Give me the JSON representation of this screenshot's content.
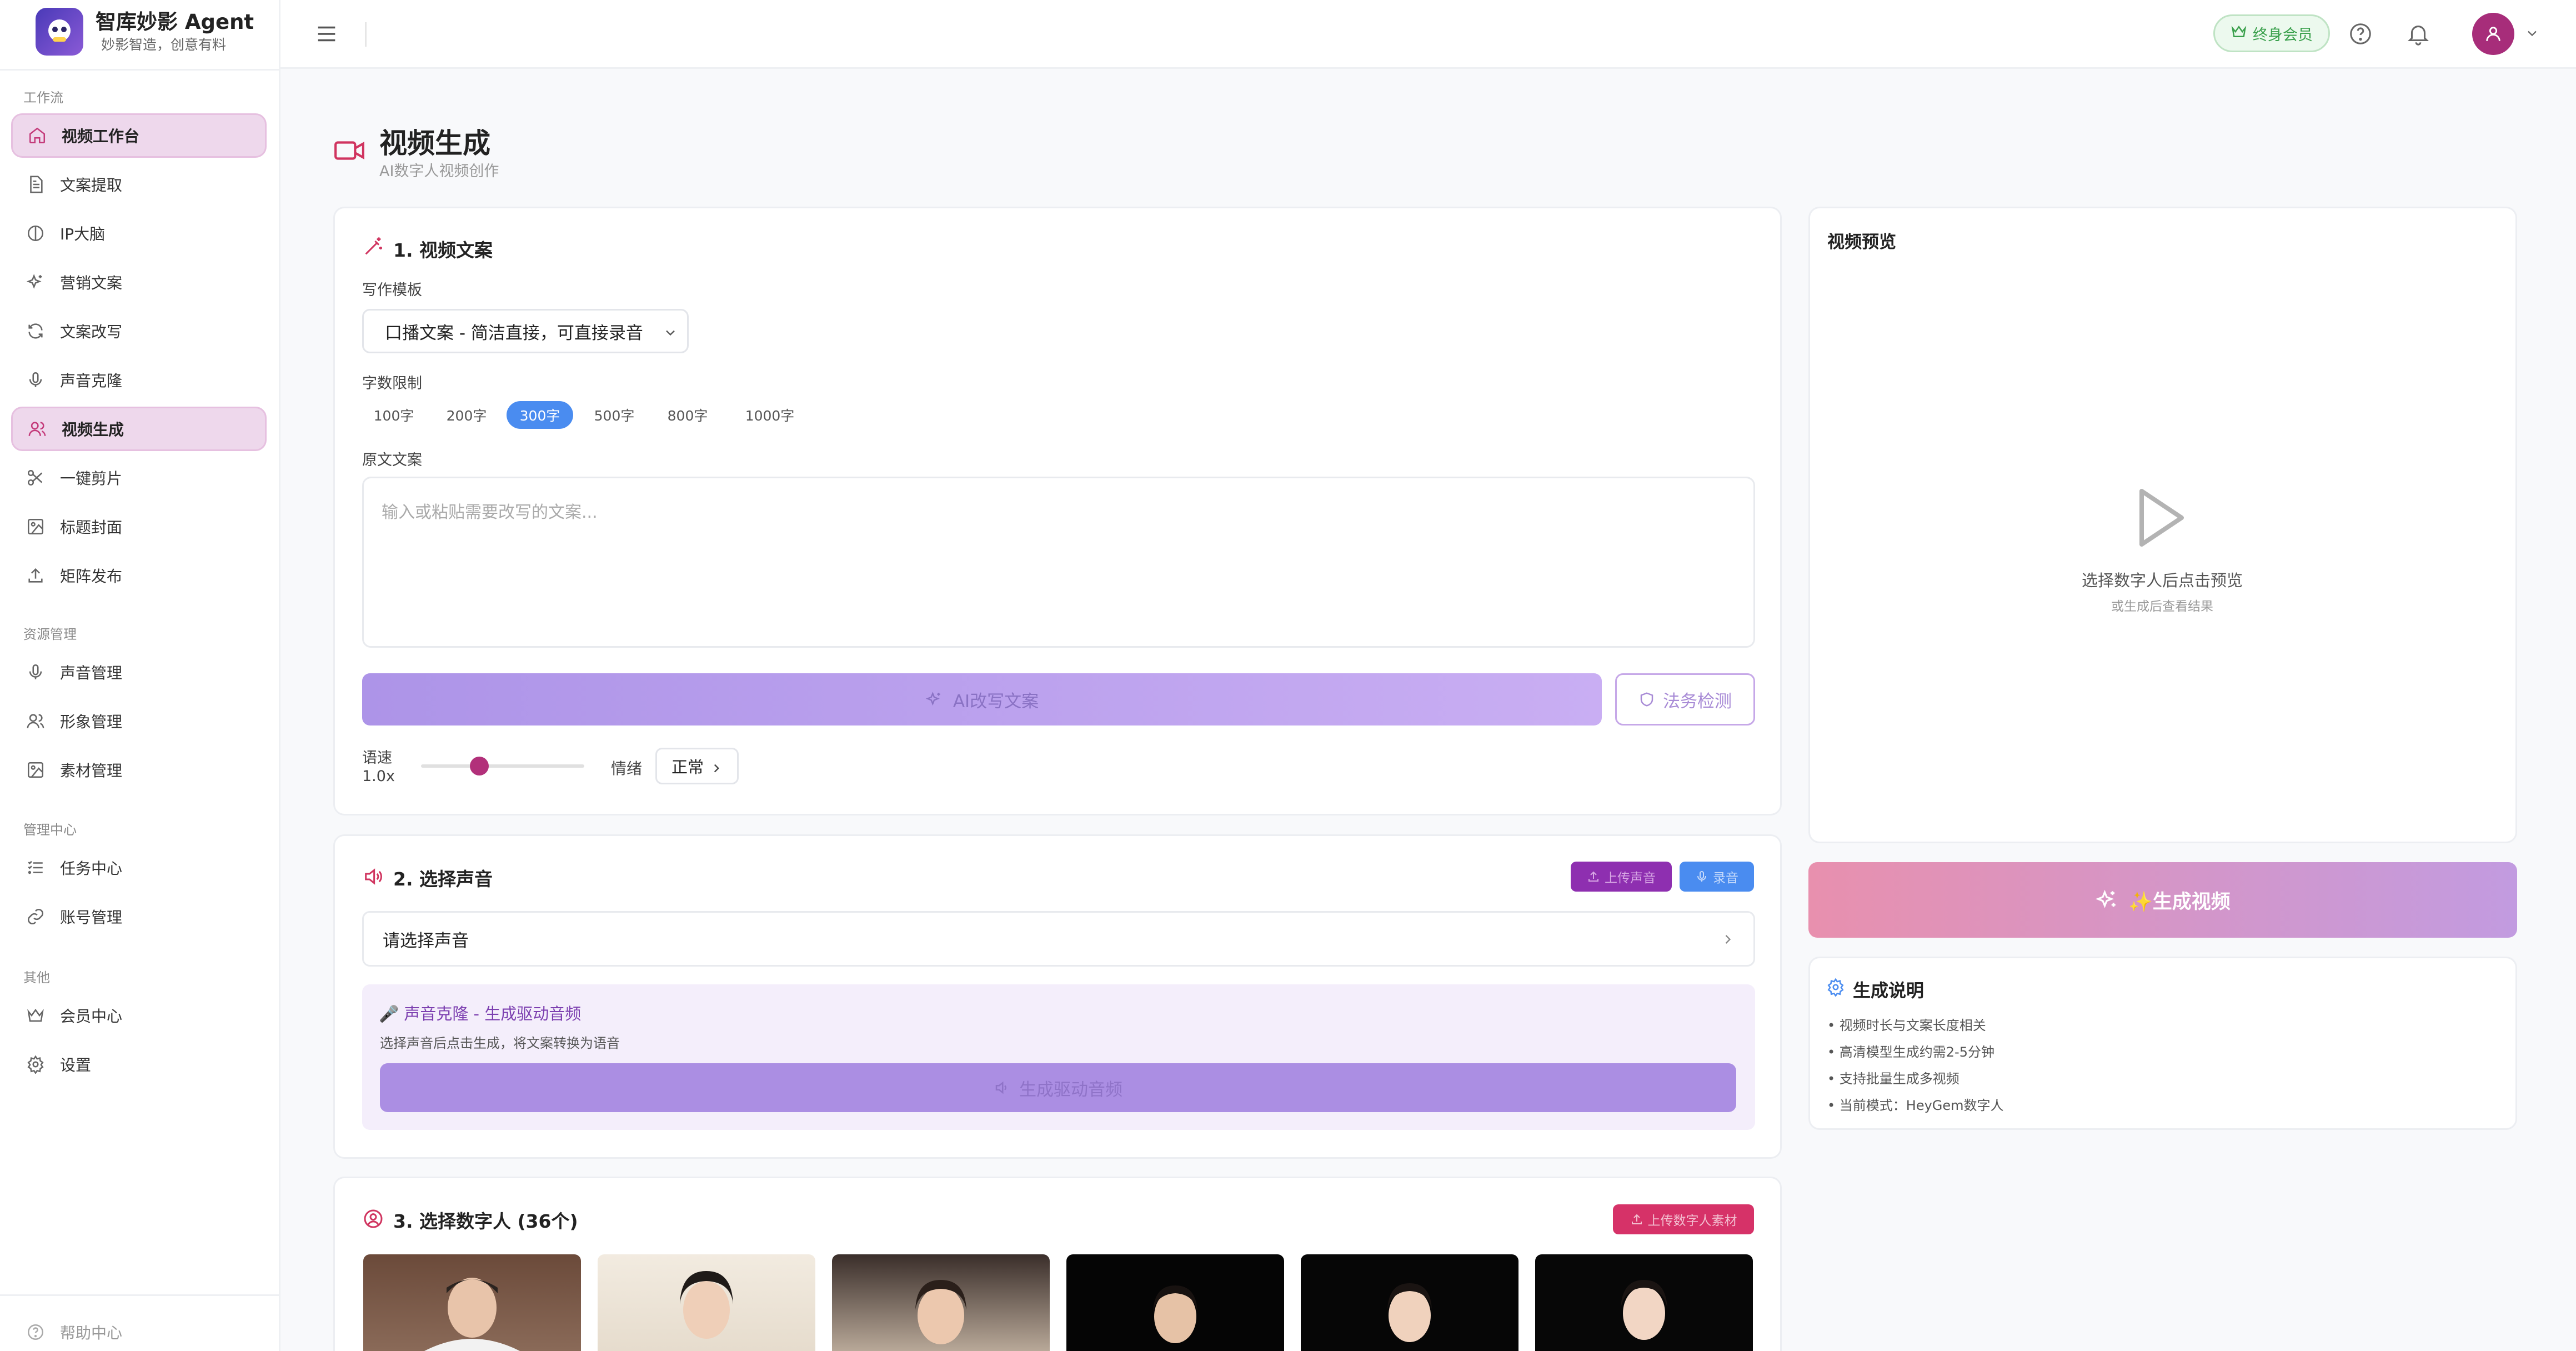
{
  "brand": {
    "title": "智库妙影 Agent",
    "subtitle": "妙影智造，创意有料"
  },
  "sidebar": {
    "sections": [
      {
        "title": "工作流",
        "items": [
          {
            "label": "视频工作台",
            "icon": "home-icon",
            "active": true
          },
          {
            "label": "文案提取",
            "icon": "document-icon",
            "active": false
          },
          {
            "label": "IP大脑",
            "icon": "brain-icon",
            "active": false
          },
          {
            "label": "营销文案",
            "icon": "sparkles-icon",
            "active": false
          },
          {
            "label": "文案改写",
            "icon": "refresh-icon",
            "active": false
          },
          {
            "label": "声音克隆",
            "icon": "microphone-icon",
            "active": false
          },
          {
            "label": "视频生成",
            "icon": "users-icon",
            "active": true
          },
          {
            "label": "一键剪片",
            "icon": "scissors-icon",
            "active": false
          },
          {
            "label": "标题封面",
            "icon": "image-icon",
            "active": false
          },
          {
            "label": "矩阵发布",
            "icon": "upload-icon",
            "active": false
          }
        ]
      },
      {
        "title": "资源管理",
        "items": [
          {
            "label": "声音管理",
            "icon": "microphone-icon",
            "active": false
          },
          {
            "label": "形象管理",
            "icon": "users-icon",
            "active": false
          },
          {
            "label": "素材管理",
            "icon": "image-icon",
            "active": false
          }
        ]
      },
      {
        "title": "管理中心",
        "items": [
          {
            "label": "任务中心",
            "icon": "list-icon",
            "active": false
          },
          {
            "label": "账号管理",
            "icon": "link-icon",
            "active": false
          }
        ]
      },
      {
        "title": "其他",
        "items": [
          {
            "label": "会员中心",
            "icon": "crown-icon",
            "active": false
          },
          {
            "label": "设置",
            "icon": "gear-icon",
            "active": false
          }
        ]
      }
    ],
    "footer": {
      "label": "帮助中心",
      "icon": "help-icon"
    }
  },
  "header": {
    "member_label": "终身会员"
  },
  "page": {
    "title": "视频生成",
    "subtitle": "AI数字人视频创作"
  },
  "script_card": {
    "title": "1. 视频文案",
    "template_label": "写作模板",
    "template_value": "口播文案 - 简洁直接，可直接录音",
    "word_limit_label": "字数限制",
    "word_limits": [
      "100字",
      "200字",
      "300字",
      "500字",
      "800字",
      "1000字"
    ],
    "word_limit_selected": "300字",
    "source_label": "原文文案",
    "source_placeholder": "输入或粘贴需要改写的文案...",
    "rewrite_button": "AI改写文案",
    "legal_button": "法务检测",
    "speed_label": "语速",
    "speed_value": "1.0x",
    "mood_label": "情绪",
    "mood_value": "正常",
    "colors": {
      "accent": "#4a8cf0",
      "button": "#ad94e8",
      "slider": "#b2307a"
    }
  },
  "voice_card": {
    "title": "2. 选择声音",
    "upload_button": "上传声音",
    "record_button": "录音",
    "select_placeholder": "请选择声音",
    "clone_title": "🎤 声音克隆 - 生成驱动音频",
    "clone_desc": "选择声音后点击生成，将文案转换为语音",
    "generate_audio_button": "生成驱动音频"
  },
  "avatar_card": {
    "title": "3. 选择数字人 (36个)",
    "upload_button": "上传数字人素材",
    "thumbnails": [
      {
        "name": "avatar-1"
      },
      {
        "name": "avatar-2"
      },
      {
        "name": "avatar-3"
      },
      {
        "name": "avatar-4"
      },
      {
        "name": "avatar-5"
      },
      {
        "name": "avatar-6"
      }
    ]
  },
  "preview": {
    "title": "视频预览",
    "hint": "选择数字人后点击预览",
    "sub_hint": "或生成后查看结果"
  },
  "generate_button": "✨生成视频",
  "info": {
    "title": "生成说明",
    "items": [
      "• 视频时长与文案长度相关",
      "• 高清模型生成约需2-5分钟",
      "• 支持批量生成多视频",
      "• 当前模式：HeyGem数字人"
    ]
  }
}
